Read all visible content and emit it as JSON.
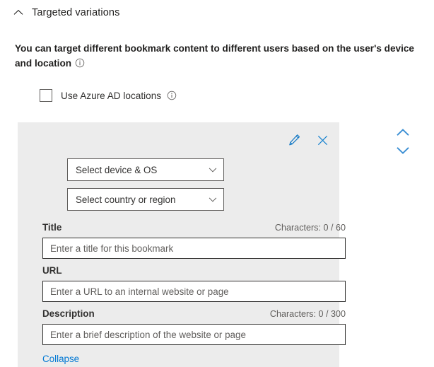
{
  "section": {
    "title": "Targeted variations",
    "collapse_icon": "chevron-up-icon",
    "description": "You can target different bookmark content to different users based on the user's device and location",
    "description_info_icon": "info-icon"
  },
  "azure_ad": {
    "checkbox_label": "Use Azure AD locations",
    "checked": false,
    "info_icon": "info-icon"
  },
  "variation_card": {
    "actions": {
      "edit_icon": "pencil-edit-icon",
      "edit_label": "Edit",
      "close_icon": "close-x-icon",
      "close_label": "Remove"
    },
    "device_dropdown": {
      "value": "Select device & OS",
      "chevron_icon": "chevron-down-icon"
    },
    "region_dropdown": {
      "value": "Select country or region",
      "chevron_icon": "chevron-down-icon"
    },
    "title_field": {
      "label": "Title",
      "counter": "Characters: 0 / 60",
      "value": "",
      "placeholder": "Enter a title for this bookmark"
    },
    "url_field": {
      "label": "URL",
      "value": "",
      "placeholder": "Enter a URL to an internal website or page"
    },
    "description_field": {
      "label": "Description",
      "counter": "Characters: 0 / 300",
      "value": "",
      "placeholder": "Enter a brief description of the website or page"
    },
    "collapse_link": "Collapse"
  },
  "reorder": {
    "move_up_icon": "chevron-up-icon",
    "move_up_label": "Move up",
    "move_down_icon": "chevron-down-icon",
    "move_down_label": "Move down"
  },
  "colors": {
    "accent": "#0078d4",
    "card_background": "#ececec",
    "text": "#323130",
    "secondary_text": "#605e5c"
  }
}
